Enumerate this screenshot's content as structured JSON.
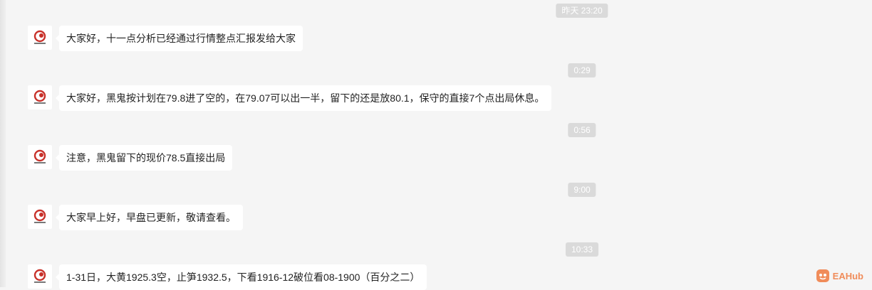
{
  "timestamps": [
    "昨天  23:20",
    "0:29",
    "0:56",
    "9:00",
    "10:33"
  ],
  "messages": [
    {
      "text": "大家好，十一点分析已经通过行情整点汇报发给大家"
    },
    {
      "text": "大家好，黑鬼按计划在79.8进了空的，在79.07可以出一半，留下的还是放80.1，保守的直接7个点出局休息。"
    },
    {
      "text": "注意，黑鬼留下的现价78.5直接出局"
    },
    {
      "text": "大家早上好，早盘已更新，敬请查看。"
    },
    {
      "text": "1-31日，大黄1925.3空，止笋1932.5，下看1916-12破位看08-1900（百分之二）"
    }
  ],
  "watermark": {
    "label": "EAHub",
    "icon": "eahub-logo-icon"
  },
  "colors": {
    "accent_red": "#c8312a",
    "watermark_orange": "#f08c5a",
    "bubble_bg": "#ffffff",
    "timestamp_bg": "#dadada"
  }
}
